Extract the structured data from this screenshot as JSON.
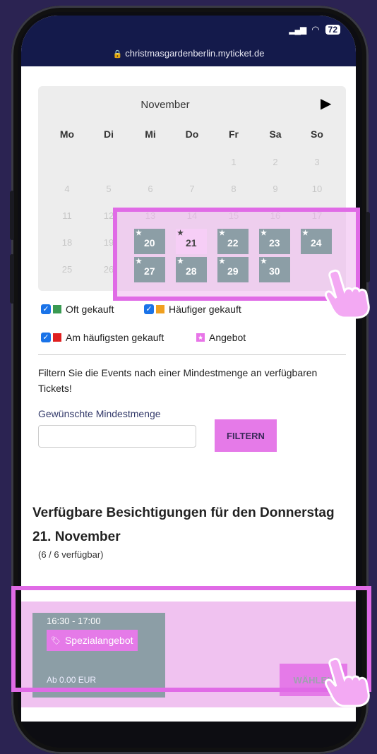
{
  "status": {
    "battery": "72",
    "url": "christmasgardenberlin.myticket.de"
  },
  "calendar": {
    "month": "November",
    "weekdays": [
      "Mo",
      "Di",
      "Mi",
      "Do",
      "Fr",
      "Sa",
      "So"
    ],
    "muted_days": {
      "r1": [
        "1",
        "2",
        "3"
      ],
      "r2": [
        "4",
        "5",
        "6",
        "7",
        "8",
        "9",
        "10"
      ],
      "r3": [
        "11",
        "12",
        "13",
        "14",
        "15",
        "16",
        "17"
      ],
      "r4": [
        "18",
        "19"
      ],
      "r5": [
        "25",
        "26"
      ]
    },
    "highlight_dates": [
      {
        "day": "20",
        "star": "★"
      },
      {
        "day": "21",
        "star": "★"
      },
      {
        "day": "22",
        "star": "★"
      },
      {
        "day": "23",
        "star": "★"
      },
      {
        "day": "24",
        "star": "★"
      },
      {
        "day": "27",
        "star": "★"
      },
      {
        "day": "28",
        "star": "★"
      },
      {
        "day": "29",
        "star": "★"
      },
      {
        "day": "30",
        "star": "★"
      }
    ],
    "selected_day": "21"
  },
  "legend": {
    "often": "Oft gekauft",
    "more_often": "Häufiger gekauft",
    "most_often": "Am häufigsten gekauft",
    "offer": "Angebot",
    "colors": {
      "green": "#3a9a52",
      "orange": "#f0a020",
      "red": "#e02020"
    }
  },
  "filter": {
    "description": "Filtern Sie die Events nach einer Mindestmenge an verfügbaren Tickets!",
    "label": "Gewünschte Mindestmenge",
    "input_value": "",
    "button": "FILTERN"
  },
  "results": {
    "heading": "Verfügbare Besichtigungen für den Donnerstag 21. November",
    "availability": "(6 / 6 verfügbar)"
  },
  "event": {
    "time": "16:30 - 17:00",
    "badge": "Spezialangebot",
    "price": "Ab 0.00 EUR",
    "button": "WÄHLEN"
  }
}
